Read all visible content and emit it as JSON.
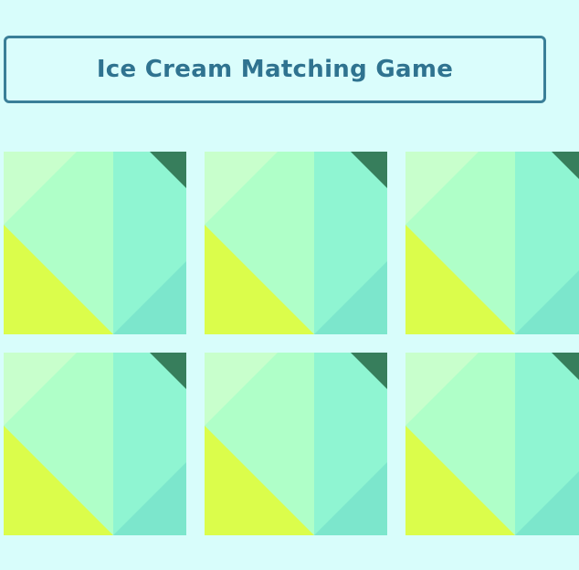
{
  "game": {
    "title": "Ice Cream Matching Game"
  },
  "board": {
    "columns": 3,
    "cards": [
      {
        "face": "down"
      },
      {
        "face": "down"
      },
      {
        "face": "down"
      },
      {
        "face": "down"
      },
      {
        "face": "down"
      },
      {
        "face": "down"
      }
    ]
  },
  "colors": {
    "background": "#d8fdfb",
    "title_border": "#3a7f98",
    "title_text": "#2f7390",
    "card_pattern": [
      "#afffc8",
      "#c8ffcc",
      "#8ff5d2",
      "#7ce6cc",
      "#dbfd4b",
      "#377e5c"
    ]
  }
}
